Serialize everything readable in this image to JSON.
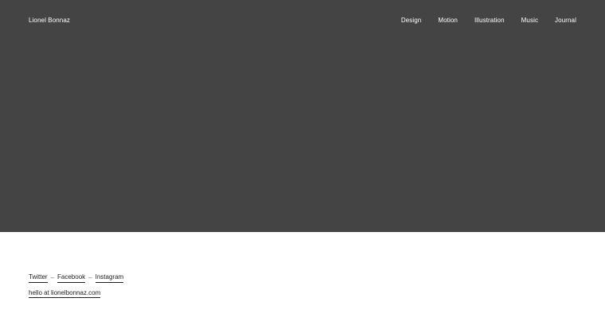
{
  "header": {
    "site_title": "Lionel Bonnaz",
    "nav": [
      "Design",
      "Motion",
      "Illustration",
      "Music",
      "Journal"
    ]
  },
  "footer": {
    "social": [
      "Twitter",
      "Facebook",
      "Instagram"
    ],
    "separator": "–",
    "email": "hello at lionelbonnaz.com"
  },
  "colors": {
    "hero_bg": "#444444",
    "page_bg": "#ffffff",
    "text_light": "#ffffff",
    "text_dark": "#222222"
  }
}
